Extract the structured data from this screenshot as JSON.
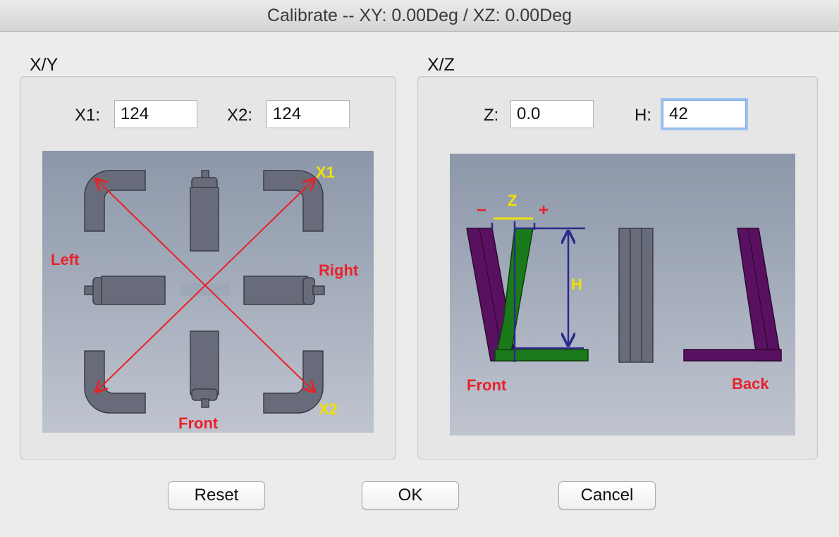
{
  "window": {
    "title": "Calibrate -- XY:  0.00Deg  /  XZ:  0.00Deg"
  },
  "xy_group": {
    "label": "X/Y",
    "x1_label": "X1:",
    "x1_value": "124",
    "x2_label": "X2:",
    "x2_value": "124",
    "diagram": {
      "label_left": "Left",
      "label_right": "Right",
      "label_front": "Front",
      "label_x1": "X1",
      "label_x2": "X2"
    }
  },
  "xz_group": {
    "label": "X/Z",
    "z_label": "Z:",
    "z_value": "0.0",
    "h_label": "H:",
    "h_value": "42",
    "diagram": {
      "label_minus": "−",
      "label_z": "Z",
      "label_plus": "+",
      "label_h": "H",
      "label_front": "Front",
      "label_back": "Back"
    }
  },
  "buttons": {
    "reset": "Reset",
    "ok": "OK",
    "cancel": "Cancel"
  },
  "colors": {
    "diagram_red": "#e8222a",
    "diagram_yellow": "#f0e000",
    "part_gray": "#686c7a",
    "purple": "#5a1060",
    "green": "#1a7a1a",
    "navy": "#2a2a8a"
  }
}
